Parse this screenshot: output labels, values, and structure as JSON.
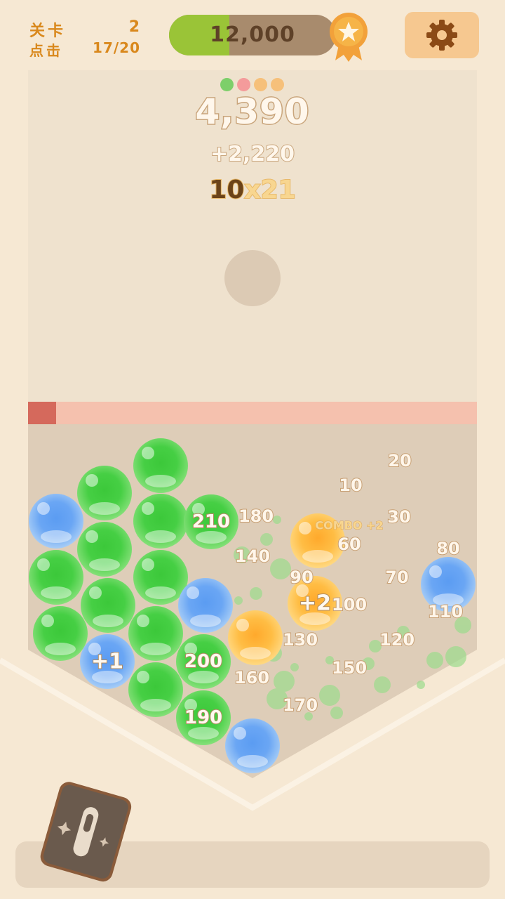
{
  "hud": {
    "level_label": "关卡",
    "level_value": "2",
    "clicks_label": "点击",
    "clicks_value": "17/20"
  },
  "score_bar": {
    "value": "12,000",
    "progress": 0.36,
    "fill_color": "#9ac437",
    "badge_icon": "star-ribbon-icon"
  },
  "settings": {
    "icon": "gear-icon"
  },
  "round": {
    "indicator_colors": [
      "#7dcf6a",
      "#f49b9b",
      "#f6c07a",
      "#f6c07a"
    ],
    "total": "4,390",
    "gain": "+2,220",
    "base": "10",
    "multiplier": "x21"
  },
  "balls": {
    "green": [
      [
        229,
        663
      ],
      [
        149,
        702
      ],
      [
        229,
        742
      ],
      [
        149,
        782
      ],
      [
        229,
        822
      ],
      [
        80,
        822
      ],
      [
        154,
        862
      ],
      [
        86,
        902
      ],
      [
        222,
        902
      ],
      [
        222,
        982
      ],
      [
        301,
        743
      ],
      [
        290,
        942
      ],
      [
        290,
        1022
      ]
    ],
    "blue": [
      [
        80,
        742
      ],
      [
        293,
        862
      ],
      [
        153,
        942
      ],
      [
        639,
        832
      ],
      [
        360,
        1062
      ]
    ],
    "yellow": [
      [
        453,
        770
      ],
      [
        449,
        859
      ],
      [
        364,
        908
      ]
    ],
    "labels": [
      {
        "text": "210",
        "at": [
          301,
          743
        ]
      },
      {
        "text": "200",
        "at": [
          290,
          942
        ]
      },
      {
        "text": "190",
        "at": [
          290,
          1022
        ]
      },
      {
        "text": "+1",
        "at": [
          153,
          942
        ]
      },
      {
        "text": "+2",
        "at": [
          449,
          859
        ]
      }
    ]
  },
  "floating_scores": [
    {
      "text": "20",
      "at": [
        570,
        656
      ]
    },
    {
      "text": "10",
      "at": [
        500,
        691
      ]
    },
    {
      "text": "180",
      "at": [
        365,
        735
      ]
    },
    {
      "text": "30",
      "at": [
        569,
        736
      ]
    },
    {
      "text": "60",
      "at": [
        498,
        775
      ]
    },
    {
      "text": "80",
      "at": [
        639,
        781
      ]
    },
    {
      "text": "140",
      "at": [
        360,
        792
      ]
    },
    {
      "text": "90",
      "at": [
        430,
        822
      ]
    },
    {
      "text": "70",
      "at": [
        566,
        822
      ]
    },
    {
      "text": "100",
      "at": [
        498,
        861
      ]
    },
    {
      "text": "110",
      "at": [
        635,
        871
      ]
    },
    {
      "text": "130",
      "at": [
        428,
        911
      ]
    },
    {
      "text": "120",
      "at": [
        566,
        911
      ]
    },
    {
      "text": "150",
      "at": [
        498,
        951
      ]
    },
    {
      "text": "160",
      "at": [
        359,
        965
      ]
    },
    {
      "text": "170",
      "at": [
        428,
        1004
      ]
    }
  ],
  "combo": {
    "text": "COMBO +2",
    "at": [
      498,
      748
    ]
  },
  "item_card": {
    "icon": "wand-card-icon"
  }
}
